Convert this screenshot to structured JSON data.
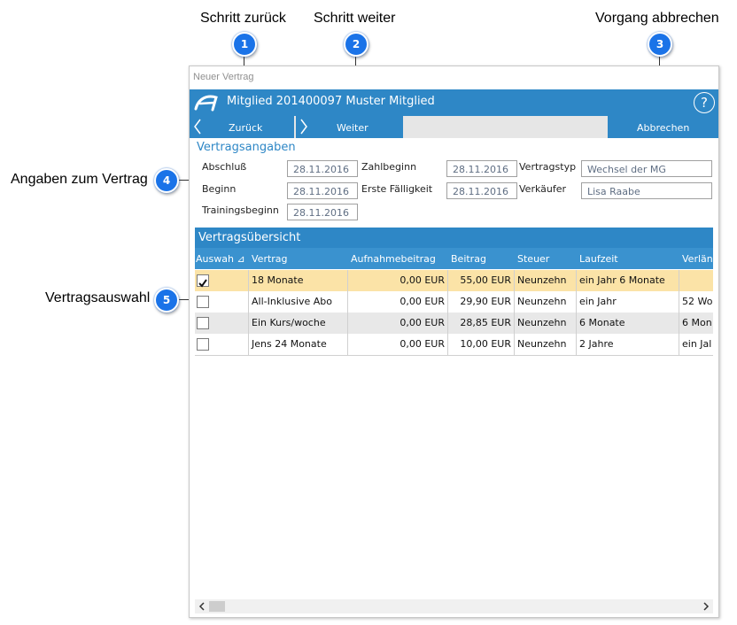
{
  "callouts": [
    {
      "num": "1",
      "label": "Schritt zurück"
    },
    {
      "num": "2",
      "label": "Schritt weiter"
    },
    {
      "num": "3",
      "label": "Vorgang abbrechen"
    },
    {
      "num": "4",
      "label": "Angaben zum Vertrag"
    },
    {
      "num": "5",
      "label": "Vertragsauswahl"
    }
  ],
  "window": {
    "title": "Neuer Vertrag",
    "header_title": "Mitglied  201400097 Muster Mitglied",
    "help": "?"
  },
  "toolbar": {
    "back_label": "Zurück",
    "next_label": "Weiter",
    "cancel_label": "Abbrechen"
  },
  "contract": {
    "section_title": "Vertragsangaben",
    "abschluss_label": "Abschluß",
    "abschluss_value": "28.11.2016",
    "beginn_label": "Beginn",
    "beginn_value": "28.11.2016",
    "training_label": "Trainingsbeginn",
    "training_value": "28.11.2016",
    "zahlbeginn_label": "Zahlbeginn",
    "zahlbeginn_value": "28.11.2016",
    "faelligkeit_label": "Erste Fälligkeit",
    "faelligkeit_value": "28.11.2016",
    "vertragstyp_label": "Vertragstyp",
    "vertragstyp_value": "Wechsel der MG",
    "verkaeufer_label": "Verkäufer",
    "verkaeufer_value": "Lisa Raabe"
  },
  "overview": {
    "title": "Vertragsübersicht",
    "columns": [
      "Auswah",
      "Vertrag",
      "Aufnahmebeitrag",
      "Beitrag",
      "Steuer",
      "Laufzeit",
      "Verlän"
    ],
    "sort_indicator": "⊿",
    "rows": [
      {
        "checked": true,
        "vertrag": "18 Monate",
        "aufnahme": "0,00 EUR",
        "beitrag": "55,00 EUR",
        "steuer": "Neunzehn",
        "laufzeit": "ein Jahr 6 Monate",
        "verl": ""
      },
      {
        "checked": false,
        "vertrag": "All-Inklusive Abo",
        "aufnahme": "0,00 EUR",
        "beitrag": "29,90 EUR",
        "steuer": "Neunzehn",
        "laufzeit": "ein Jahr",
        "verl": "52 Wo"
      },
      {
        "checked": false,
        "vertrag": "Ein Kurs/woche",
        "aufnahme": "0,00 EUR",
        "beitrag": "28,85 EUR",
        "steuer": "Neunzehn",
        "laufzeit": "6 Monate",
        "verl": "6 Mon"
      },
      {
        "checked": false,
        "vertrag": "Jens 24 Monate",
        "aufnahme": "0,00 EUR",
        "beitrag": "10,00 EUR",
        "steuer": "Neunzehn",
        "laufzeit": "2 Jahre",
        "verl": "ein Jal"
      }
    ]
  },
  "colors": {
    "accent": "#2e87c6",
    "callout": "#1a73e8",
    "selected_row": "#fbe3a7",
    "alt_row": "#e8e8e8"
  }
}
